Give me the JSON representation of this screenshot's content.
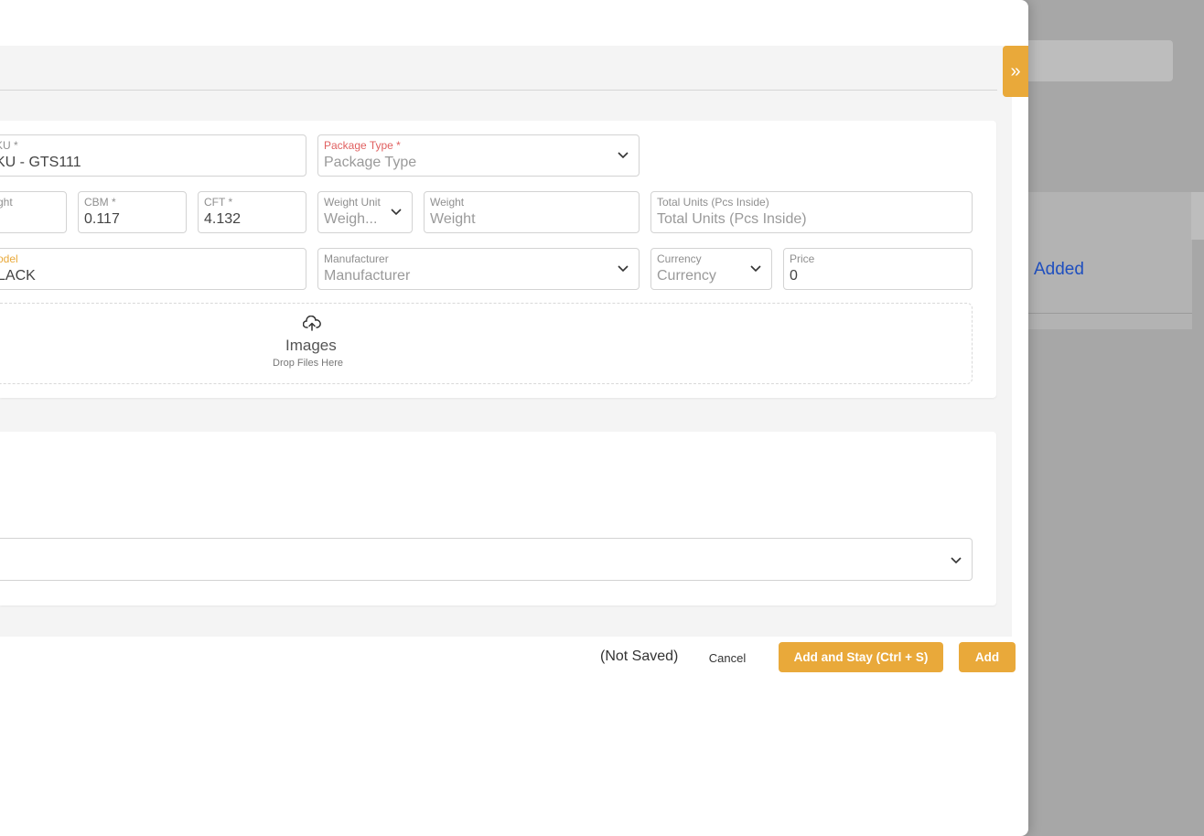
{
  "background": {
    "list_status": "Added"
  },
  "dialog": {
    "expand_icon": "double-chevron-right-icon",
    "fields": {
      "sku": {
        "label": "KU *",
        "value": "KU - GTS111"
      },
      "package_type": {
        "label": "Package Type *",
        "placeholder": "Package Type"
      },
      "height": {
        "label": "ght",
        "value": ""
      },
      "cbm": {
        "label": "CBM *",
        "value": "0.117"
      },
      "cft": {
        "label": "CFT *",
        "value": "4.132"
      },
      "weight_unit": {
        "label": "Weight Unit",
        "placeholder": "Weigh..."
      },
      "weight": {
        "label": "Weight",
        "placeholder": "Weight"
      },
      "total_units": {
        "label": "Total Units (Pcs Inside)",
        "placeholder": "Total Units (Pcs Inside)"
      },
      "model": {
        "label": "odel",
        "value": "LACK"
      },
      "manufacturer": {
        "label": "Manufacturer",
        "placeholder": "Manufacturer"
      },
      "currency": {
        "label": "Currency",
        "placeholder": "Currency"
      },
      "price": {
        "label": "Price",
        "value": "0"
      }
    },
    "images": {
      "title": "Images",
      "hint": "Drop Files Here",
      "icon": "cloud-upload-icon"
    }
  },
  "footer": {
    "status": "(Not Saved)",
    "cancel_label": "Cancel",
    "add_stay_label": "Add and Stay (Ctrl + S)",
    "add_label": "Add"
  },
  "colors": {
    "accent": "#e9a93a",
    "required_label": "#e06060",
    "link": "#1f4fbf"
  }
}
